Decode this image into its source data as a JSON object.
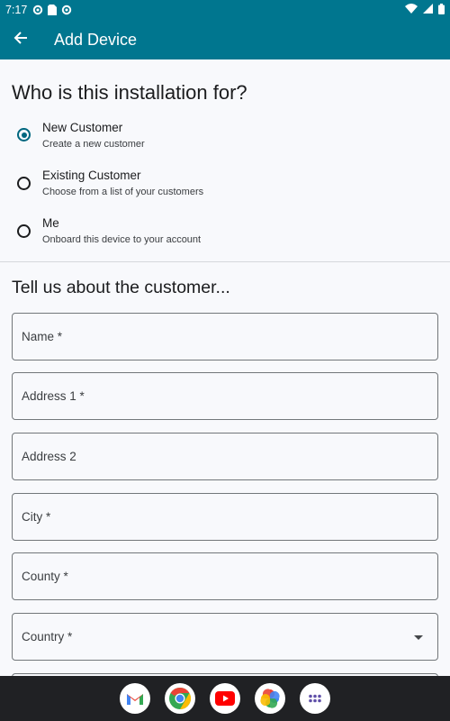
{
  "status_bar": {
    "time": "7:17"
  },
  "app_bar": {
    "title": "Add Device"
  },
  "installation": {
    "heading": "Who is this installation for?",
    "options": [
      {
        "label": "New Customer",
        "description": "Create a new customer",
        "selected": true
      },
      {
        "label": "Existing Customer",
        "description": "Choose from a list of your customers",
        "selected": false
      },
      {
        "label": "Me",
        "description": "Onboard this device to your account",
        "selected": false
      }
    ]
  },
  "customer_form": {
    "heading": "Tell us about the customer...",
    "fields": {
      "name": {
        "placeholder": "Name *"
      },
      "address1": {
        "placeholder": "Address 1 *"
      },
      "address2": {
        "placeholder": "Address 2"
      },
      "city": {
        "placeholder": "City *"
      },
      "county": {
        "placeholder": "County *"
      },
      "country": {
        "placeholder": "Country *"
      }
    }
  },
  "dock": {
    "apps": [
      "gmail-icon",
      "chrome-icon",
      "youtube-icon",
      "photos-icon",
      "app-drawer-icon"
    ]
  },
  "colors": {
    "primary": "#00768f",
    "radio_accent": "#00677f",
    "nav_bar": "#202124"
  }
}
